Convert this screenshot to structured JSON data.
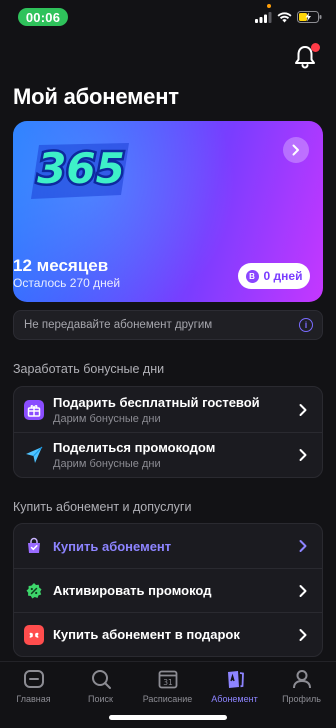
{
  "status": {
    "time": "00:06"
  },
  "page_title": "Мой абонемент",
  "card": {
    "months": "12 месяцев",
    "remaining": "Осталось 270 дней",
    "bonus_badge": "B",
    "bonus_days": "0 дней",
    "logo": "365"
  },
  "warning_text": "Не передавайте абонемент другим",
  "bonus_section": {
    "title": "Заработать бонусные дни",
    "items": [
      {
        "title": "Подарить бесплатный гостевой",
        "subtitle": "Дарим бонусные дни",
        "icon": "gift-icon"
      },
      {
        "title": "Поделиться промокодом",
        "subtitle": "Дарим бонусные дни",
        "icon": "send-icon"
      }
    ]
  },
  "buy_section": {
    "title": "Купить абонемент и допуслуги",
    "items": [
      {
        "title": "Купить абонемент",
        "icon": "shopping-bag-icon",
        "accent": true
      },
      {
        "title": "Активировать промокод",
        "icon": "percent-badge-icon"
      },
      {
        "title": "Купить абонемент в подарок",
        "icon": "gift-bow-icon"
      }
    ]
  },
  "nav": {
    "items": [
      {
        "label": "Главная",
        "icon": "home-icon"
      },
      {
        "label": "Поиск",
        "icon": "search-icon"
      },
      {
        "label": "Расписание",
        "icon": "calendar-icon",
        "calendar_day": "31"
      },
      {
        "label": "Абонемент",
        "icon": "membership-card-icon",
        "active": true
      },
      {
        "label": "Профиль",
        "icon": "profile-icon"
      }
    ]
  },
  "colors": {
    "accent": "#8d84ff",
    "background": "#121215",
    "time_pill": "#2fc25b",
    "notification_dot": "#ff3b47"
  }
}
